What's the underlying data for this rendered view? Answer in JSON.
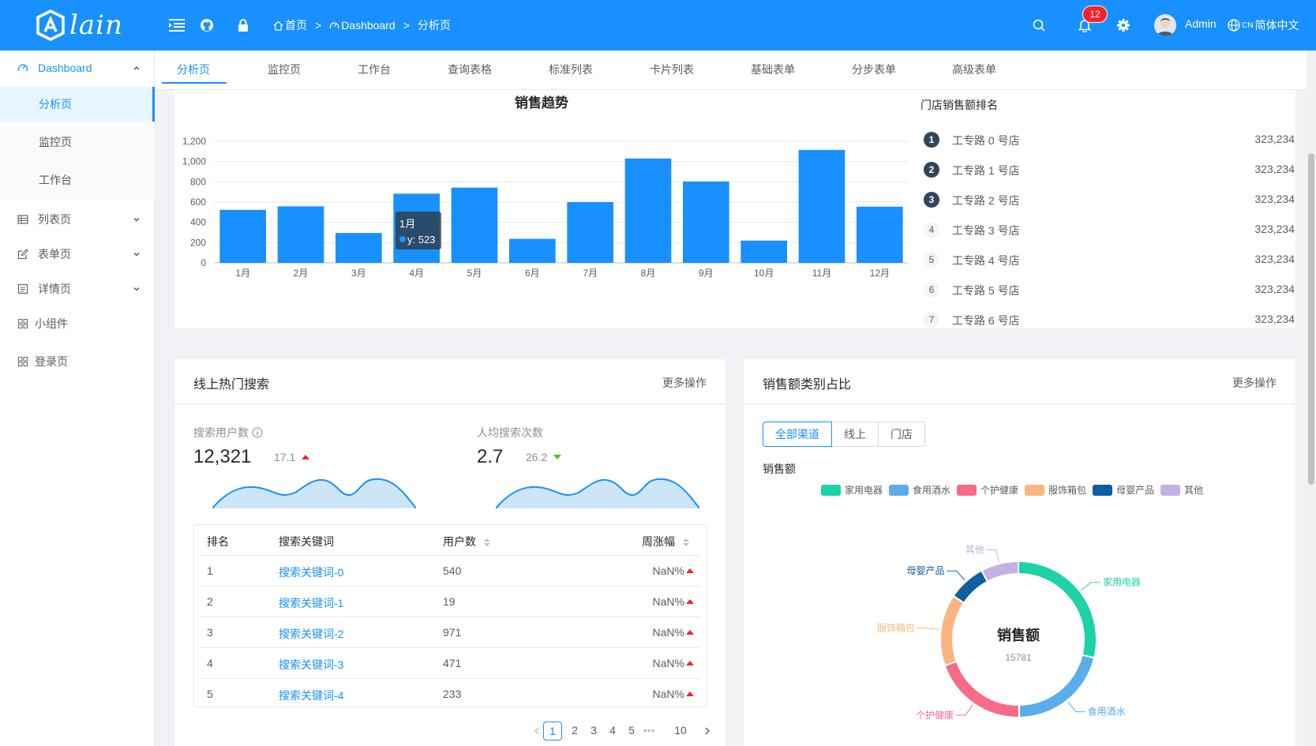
{
  "header": {
    "logo_text": "lain",
    "breadcrumb": [
      "首页",
      "Dashboard",
      "分析页"
    ],
    "breadcrumb_sep": ">",
    "notification_count": "12",
    "user_name": "Admin",
    "lang_prefix": "CN",
    "language": "简体中文"
  },
  "sidebar": {
    "dashboard": "Dashboard",
    "sub_items": [
      "分析页",
      "监控页",
      "工作台"
    ],
    "items": [
      "列表页",
      "表单页",
      "详情页",
      "小组件",
      "登录页"
    ]
  },
  "tabs": [
    "分析页",
    "监控页",
    "工作台",
    "查询表格",
    "标准列表",
    "卡片列表",
    "基础表单",
    "分步表单",
    "高级表单"
  ],
  "sales_trend": {
    "tooltip_month": "1月",
    "tooltip_value": "y: 523"
  },
  "ranking": {
    "title": "门店销售额排名",
    "items": [
      {
        "rank": "1",
        "name": "工专路 0 号店",
        "value": "323,234"
      },
      {
        "rank": "2",
        "name": "工专路 1 号店",
        "value": "323,234"
      },
      {
        "rank": "3",
        "name": "工专路 2 号店",
        "value": "323,234"
      },
      {
        "rank": "4",
        "name": "工专路 3 号店",
        "value": "323,234"
      },
      {
        "rank": "5",
        "name": "工专路 4 号店",
        "value": "323,234"
      },
      {
        "rank": "6",
        "name": "工专路 5 号店",
        "value": "323,234"
      },
      {
        "rank": "7",
        "name": "工专路 6 号店",
        "value": "323,234"
      }
    ]
  },
  "hot_search": {
    "title": "线上热门搜索",
    "extra": "更多操作",
    "users_label": "搜索用户数",
    "users_value": "12,321",
    "users_change": "17.1",
    "avg_label": "人均搜索次数",
    "avg_value": "2.7",
    "avg_change": "26.2",
    "columns": [
      "排名",
      "搜索关键词",
      "用户数",
      "周涨幅"
    ],
    "rows": [
      {
        "rank": "1",
        "keyword": "搜索关键词-0",
        "count": "540",
        "range": "NaN%"
      },
      {
        "rank": "2",
        "keyword": "搜索关键词-1",
        "count": "19",
        "range": "NaN%"
      },
      {
        "rank": "3",
        "keyword": "搜索关键词-2",
        "count": "971",
        "range": "NaN%"
      },
      {
        "rank": "4",
        "keyword": "搜索关键词-3",
        "count": "471",
        "range": "NaN%"
      },
      {
        "rank": "5",
        "keyword": "搜索关键词-4",
        "count": "233",
        "range": "NaN%"
      }
    ],
    "pagination": [
      "1",
      "2",
      "3",
      "4",
      "5",
      "•••",
      "10"
    ]
  },
  "sales_category": {
    "title": "销售额类别占比",
    "extra": "更多操作",
    "radios": [
      "全部渠道",
      "线上",
      "门店"
    ],
    "subtitle": "销售额",
    "center_title": "销售额",
    "center_value": "15781",
    "colors": [
      "#1cd2a6",
      "#5aacec",
      "#f76b87",
      "#fcb57e",
      "#0e5f9e",
      "#c3b2e2"
    ]
  },
  "chart_data": [
    {
      "type": "bar",
      "title": "销售趋势",
      "categories": [
        "1月",
        "2月",
        "3月",
        "4月",
        "5月",
        "6月",
        "7月",
        "8月",
        "9月",
        "10月",
        "11月",
        "12月"
      ],
      "values": [
        523,
        558,
        295,
        683,
        743,
        237,
        600,
        1030,
        803,
        220,
        1115,
        555
      ],
      "ylim": [
        0,
        1200
      ],
      "yticks": [
        "0",
        "200",
        "400",
        "600",
        "800",
        "1,000",
        "1,200"
      ],
      "grid": true,
      "color": "#1890ff"
    },
    {
      "type": "pie",
      "title": "",
      "categories": [
        "家用电器",
        "食用酒水",
        "个护健康",
        "服饰箱包",
        "母婴产品",
        "其他"
      ],
      "values": [
        4544,
        3321,
        3113,
        2341,
        1231,
        1231
      ],
      "legend": "top",
      "colors": [
        "#1cd2a6",
        "#5aacec",
        "#f76b87",
        "#fcb57e",
        "#0e5f9e",
        "#c3b2e2"
      ]
    }
  ]
}
